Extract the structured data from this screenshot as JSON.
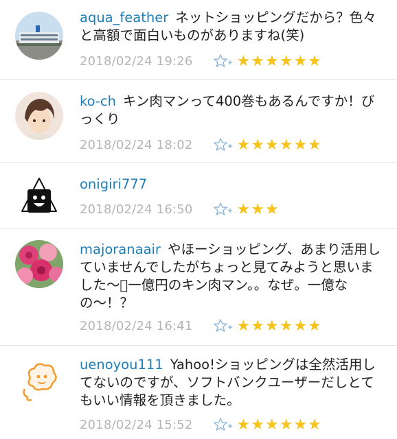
{
  "comments": [
    {
      "username": "aqua_feather",
      "text": "ネットショッピングだから？色々と高額で面白いものがありますね(笑)",
      "timestamp": "2018/02/24 19:26",
      "rating": 6,
      "stars": "★★★★★★",
      "avatar_icon": "building-photo-avatar"
    },
    {
      "username": "ko-ch",
      "text": "キン肉マンって400巻もあるんですか！びっくり",
      "timestamp": "2018/02/24 18:02",
      "rating": 6,
      "stars": "★★★★★★",
      "avatar_icon": "anime-character-avatar"
    },
    {
      "username": "onigiri777",
      "text": "",
      "timestamp": "2018/02/24 16:50",
      "rating": 3,
      "stars": "★★★",
      "avatar_icon": "onigiri-avatar"
    },
    {
      "username": "majoranaair",
      "text": "やほーショッピング、あまり活用していませんでしたがちょっと見てみようと思いました〜\u0000一億円のキン肉マン。。なぜ。一億なの〜！？",
      "timestamp": "2018/02/24 16:41",
      "rating": 6,
      "stars": "★★★★★★",
      "avatar_icon": "rose-flowers-avatar"
    },
    {
      "username": "uenoyou111",
      "text": "Yahoo!ショッピングは全然活用してないのですが、ソフトバンクユーザーだしとてもいい情報を頂きました。",
      "timestamp": "2018/02/24 15:52",
      "rating": 6,
      "stars": "★★★★★★",
      "avatar_icon": "orange-mascot-avatar"
    }
  ],
  "colors": {
    "username": "#1e7fb8",
    "timestamp": "#b5b5b5",
    "star": "#f6c21c",
    "fav_icon": "#8fb9dc"
  },
  "icons": {
    "favorite_add": "star-plus-icon"
  }
}
